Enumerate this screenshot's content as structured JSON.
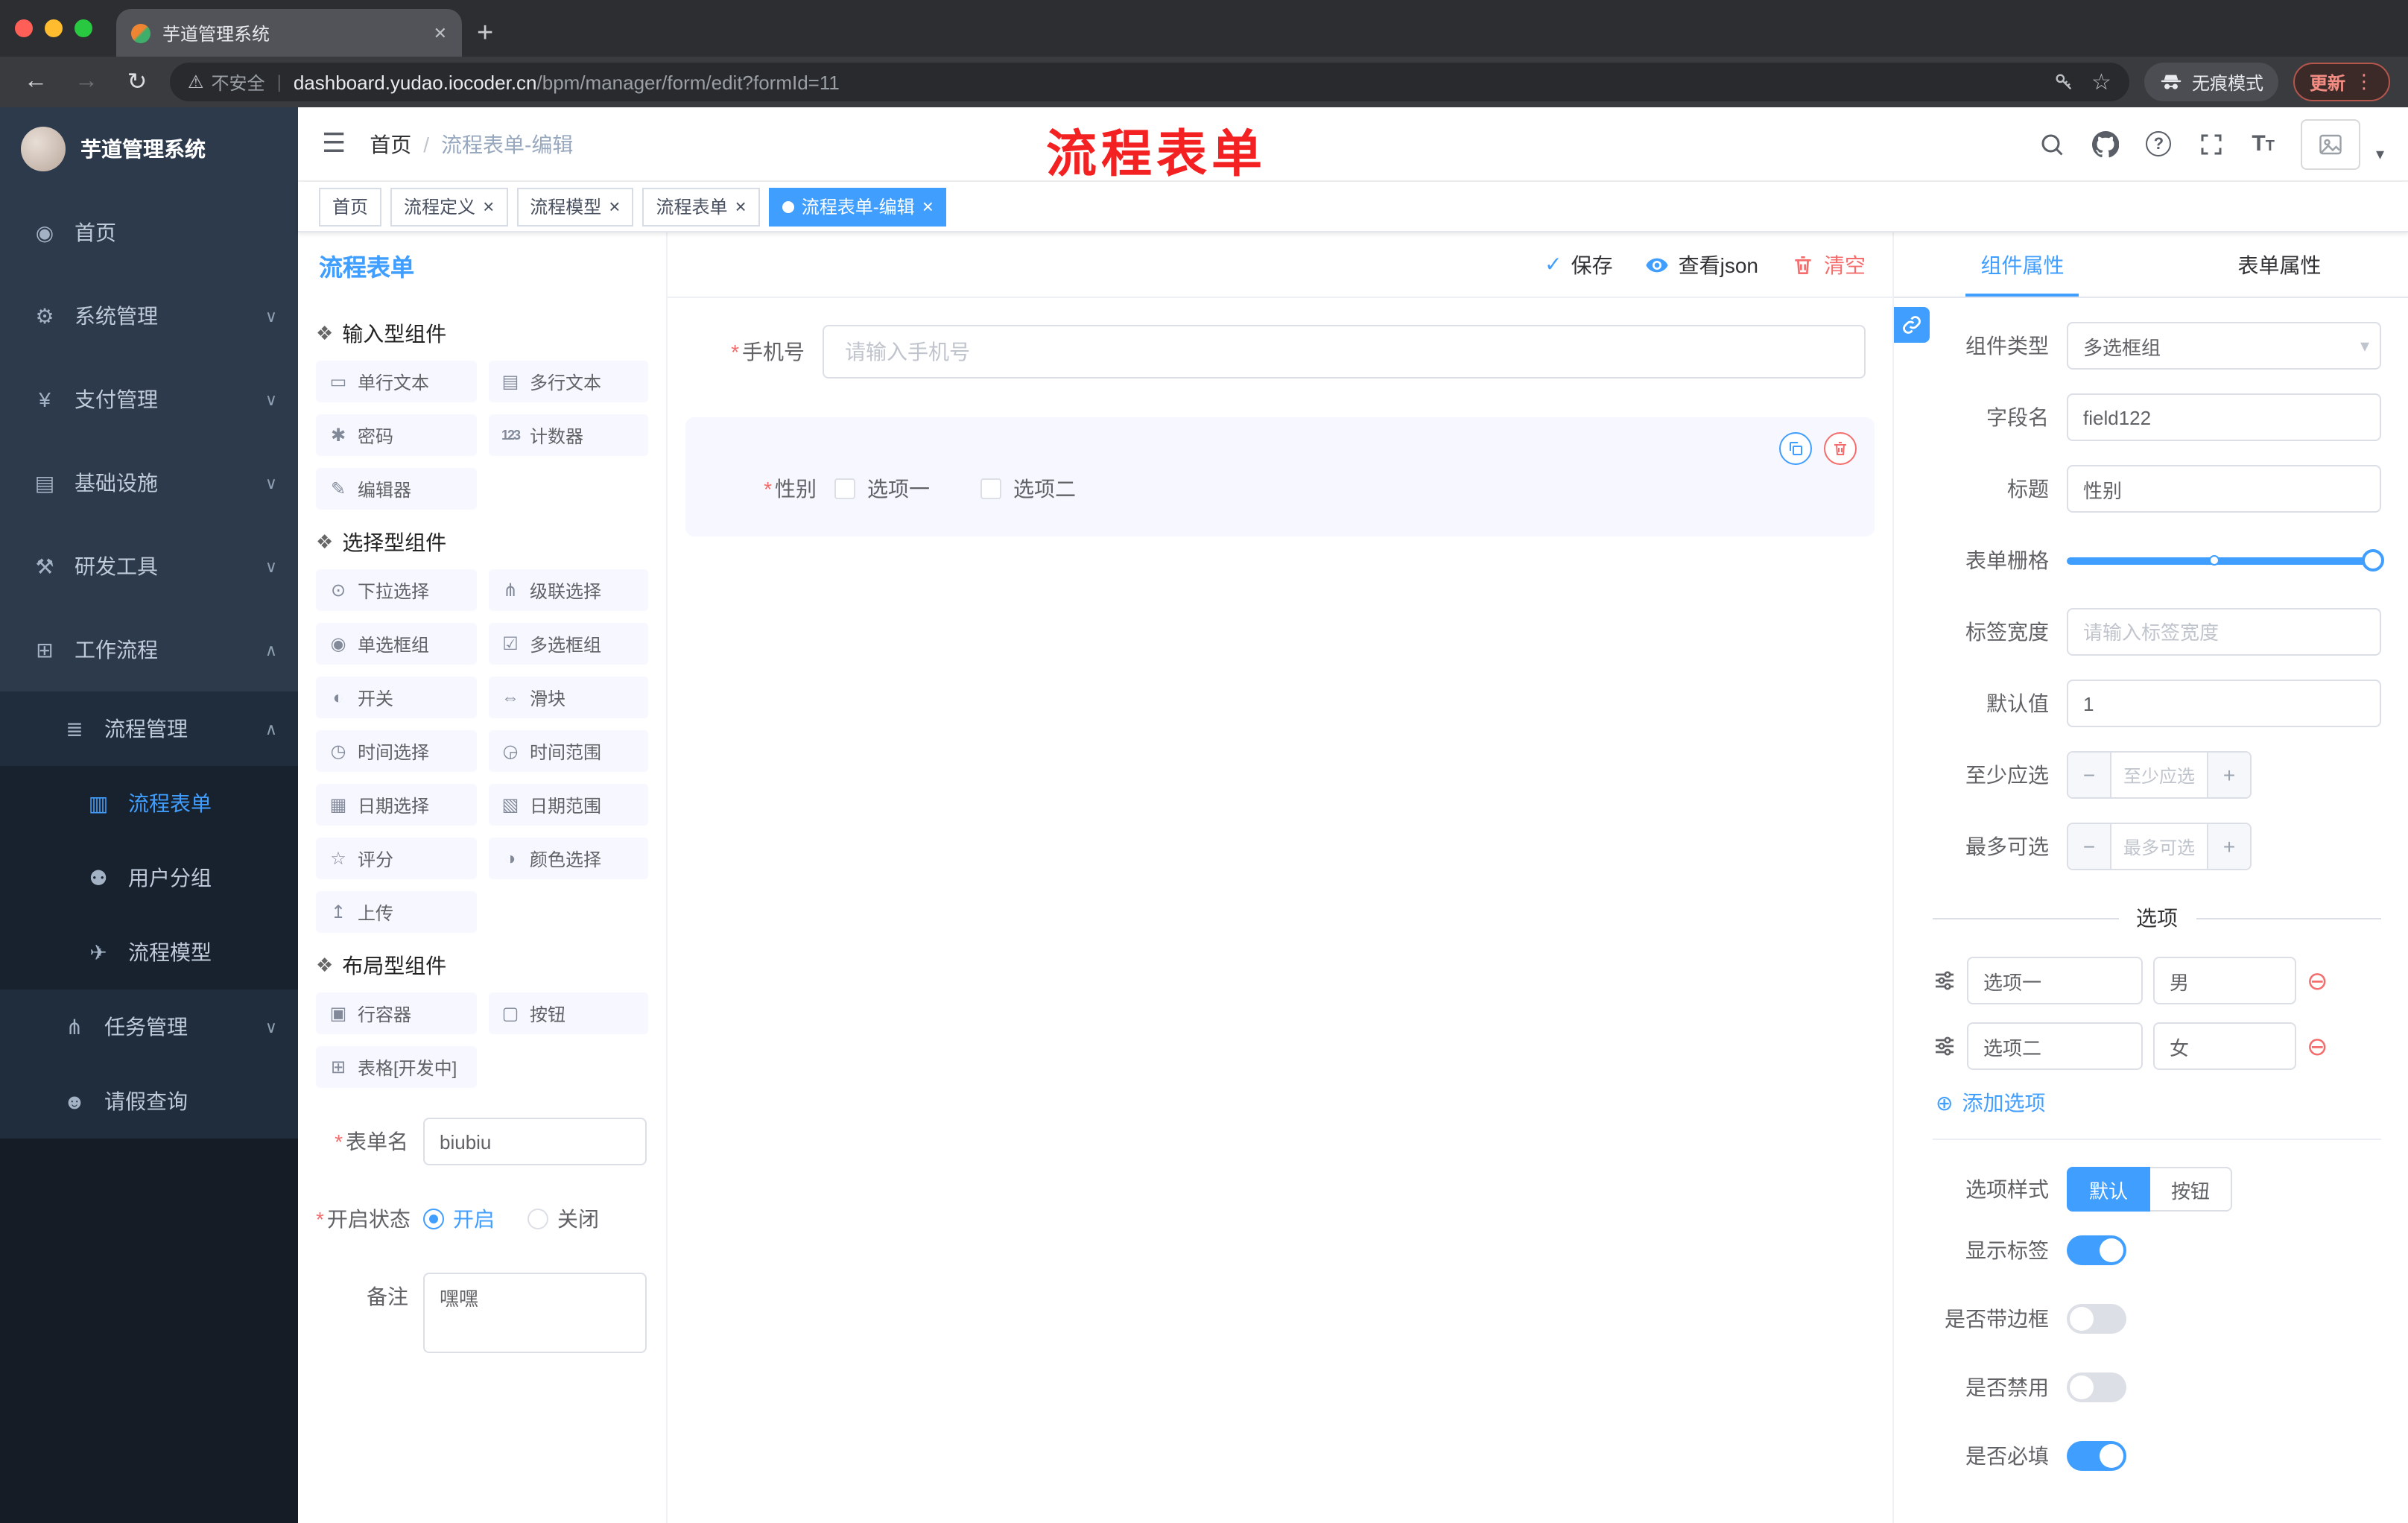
{
  "colors": {
    "accent": "#409eff",
    "danger": "#f56c6c",
    "annotation_red": "#f32121",
    "sidebar_dark": "#2d3a4b"
  },
  "icons": {
    "tab_close": "✕",
    "new_tab": "+",
    "back": "←",
    "forward": "→",
    "reload": "↻",
    "warning": "⚠",
    "star": "☆",
    "dots": "⋮",
    "hamburger": "☰",
    "crumb_sep": "/",
    "question": "?",
    "t_big": "T",
    "t_small": "T",
    "avatar_caret": "▾",
    "menu_home": "◉",
    "menu_system": "⚙",
    "menu_pay": "¥",
    "menu_infra": "▤",
    "menu_dev": "⚒",
    "menu_flow": "⊞",
    "menu_flowmgmt": "≣",
    "menu_form": "▥",
    "menu_group": "⚉",
    "menu_model": "✈",
    "menu_task": "⋔",
    "menu_leave": "☻",
    "chev_down": "∨",
    "chev_up": "∧",
    "group_cube": "❖",
    "c_text": "▭",
    "c_textarea": "▤",
    "c_password": "✱",
    "c_counter": "123",
    "c_editor": "✎",
    "c_select": "⊙",
    "c_cascader": "⋔",
    "c_radio": "◉",
    "c_checkbox": "☑",
    "c_switch": "◐",
    "c_slider": "⇔",
    "c_time": "◷",
    "c_timerange": "◶",
    "c_date": "▦",
    "c_daterange": "▧",
    "c_rate": "☆",
    "c_color": "◑",
    "c_upload": "↥",
    "c_row": "▣",
    "c_button": "▢",
    "c_table": "⊞",
    "check": "✓",
    "asterisk": "*",
    "caret": "▾",
    "minus": "−",
    "plus": "+",
    "add_circle": "⊕",
    "remove_circle": "⊖",
    "tag_close": "×"
  },
  "browser": {
    "tab_title": "芋道管理系统",
    "address": {
      "security": "不安全",
      "divider": "|",
      "domain": "dashboard.yudao.iocoder.cn",
      "path": "/bpm/manager/form/edit?formId=11"
    },
    "incognito_label": "无痕模式",
    "update_label": "更新"
  },
  "annotation": "流程表单",
  "sidebar": {
    "logo_title": "芋道管理系统",
    "items": [
      {
        "label": "首页"
      },
      {
        "label": "系统管理"
      },
      {
        "label": "支付管理"
      },
      {
        "label": "基础设施"
      },
      {
        "label": "研发工具"
      },
      {
        "label": "工作流程"
      },
      {
        "label": "流程管理"
      },
      {
        "label": "流程表单"
      },
      {
        "label": "用户分组"
      },
      {
        "label": "流程模型"
      },
      {
        "label": "任务管理"
      },
      {
        "label": "请假查询"
      }
    ]
  },
  "navbar": {
    "breadcrumb_home": "首页",
    "breadcrumb_current": "流程表单-编辑"
  },
  "tags": [
    {
      "label": "首页"
    },
    {
      "label": "流程定义"
    },
    {
      "label": "流程模型"
    },
    {
      "label": "流程表单"
    },
    {
      "label": "流程表单-编辑"
    }
  ],
  "designer": {
    "panel_title": "流程表单",
    "actions": {
      "save": "保存",
      "view_json": "查看json",
      "clear": "清空"
    },
    "groups": [
      {
        "title": "输入型组件",
        "items": [
          "单行文本",
          "多行文本",
          "密码",
          "计数器",
          "编辑器"
        ]
      },
      {
        "title": "选择型组件",
        "items": [
          "下拉选择",
          "级联选择",
          "单选框组",
          "多选框组",
          "开关",
          "滑块",
          "时间选择",
          "时间范围",
          "日期选择",
          "日期范围",
          "评分",
          "颜色选择",
          "上传"
        ]
      },
      {
        "title": "布局型组件",
        "items": [
          "行容器",
          "按钮",
          "表格[开发中]"
        ]
      }
    ],
    "settings": {
      "form_name_label": "表单名",
      "form_name_value": "biubiu",
      "status_label": "开启状态",
      "status_on": "开启",
      "status_off": "关闭",
      "remark_label": "备注",
      "remark_value": "嘿嘿"
    },
    "canvas": {
      "phone_label": "手机号",
      "phone_placeholder": "请输入手机号",
      "gender_label": "性别",
      "gender_opt1": "选项一",
      "gender_opt2": "选项二"
    }
  },
  "props": {
    "tab_component": "组件属性",
    "tab_form": "表单属性",
    "type_label": "组件类型",
    "type_value": "多选框组",
    "field_label": "字段名",
    "field_value": "field122",
    "title_label": "标题",
    "title_value": "性别",
    "grid_label": "表单栅格",
    "width_label": "标签宽度",
    "width_placeholder": "请输入标签宽度",
    "default_label": "默认值",
    "default_value": "1",
    "min_label": "至少应选",
    "min_placeholder": "至少应选",
    "max_label": "最多可选",
    "max_placeholder": "最多可选",
    "options_title": "选项",
    "options": [
      {
        "label": "选项一",
        "value": "男"
      },
      {
        "label": "选项二",
        "value": "女"
      }
    ],
    "add_option": "添加选项",
    "style_label": "选项样式",
    "style_default": "默认",
    "style_button": "按钮",
    "toggle_show_label": "显示标签",
    "toggle_border": "是否带边框",
    "toggle_disabled": "是否禁用",
    "toggle_required": "是否必填"
  }
}
